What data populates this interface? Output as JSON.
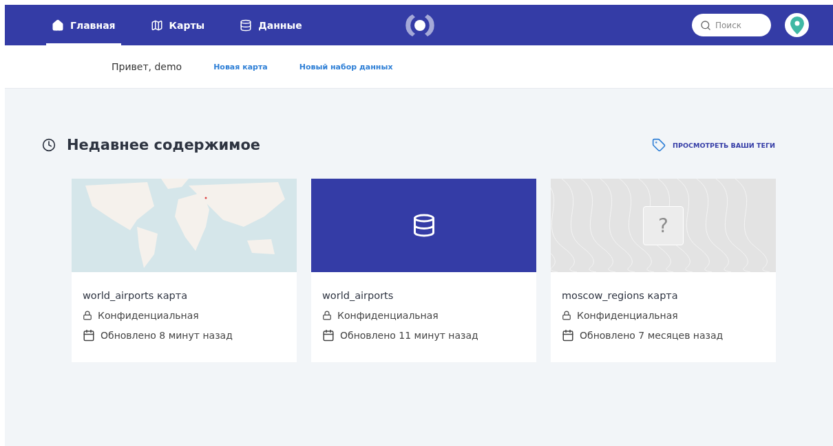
{
  "nav": {
    "tabs": [
      {
        "label": "Главная",
        "selected": true
      },
      {
        "label": "Карты",
        "selected": false
      },
      {
        "label": "Данные",
        "selected": false
      }
    ],
    "search": {
      "placeholder": "Поиск"
    }
  },
  "subbar": {
    "greeting": "Привет, demo",
    "links": [
      "Новая карта",
      "Новый набор данных"
    ]
  },
  "recent": {
    "title": "Недавнее содержимое",
    "tags_link": "ПРОСМОТРЕТЬ ВАШИ ТЕГИ",
    "cards": [
      {
        "thumbnail": {
          "kind": "map"
        },
        "title": "world_airports карта",
        "privacy": "Конфиденциальная",
        "updated": "Обновлено 8 минут назад"
      },
      {
        "thumbnail": {
          "kind": "dataset"
        },
        "title": "world_airports",
        "privacy": "Конфиденциальная",
        "updated": "Обновлено 11 минут назад"
      },
      {
        "thumbnail": {
          "kind": "placeholder",
          "symbol": "?"
        },
        "title": "moscow_regions карта",
        "privacy": "Конфиденциальная",
        "updated": "Обновлено 7 месяцев назад"
      }
    ]
  }
}
